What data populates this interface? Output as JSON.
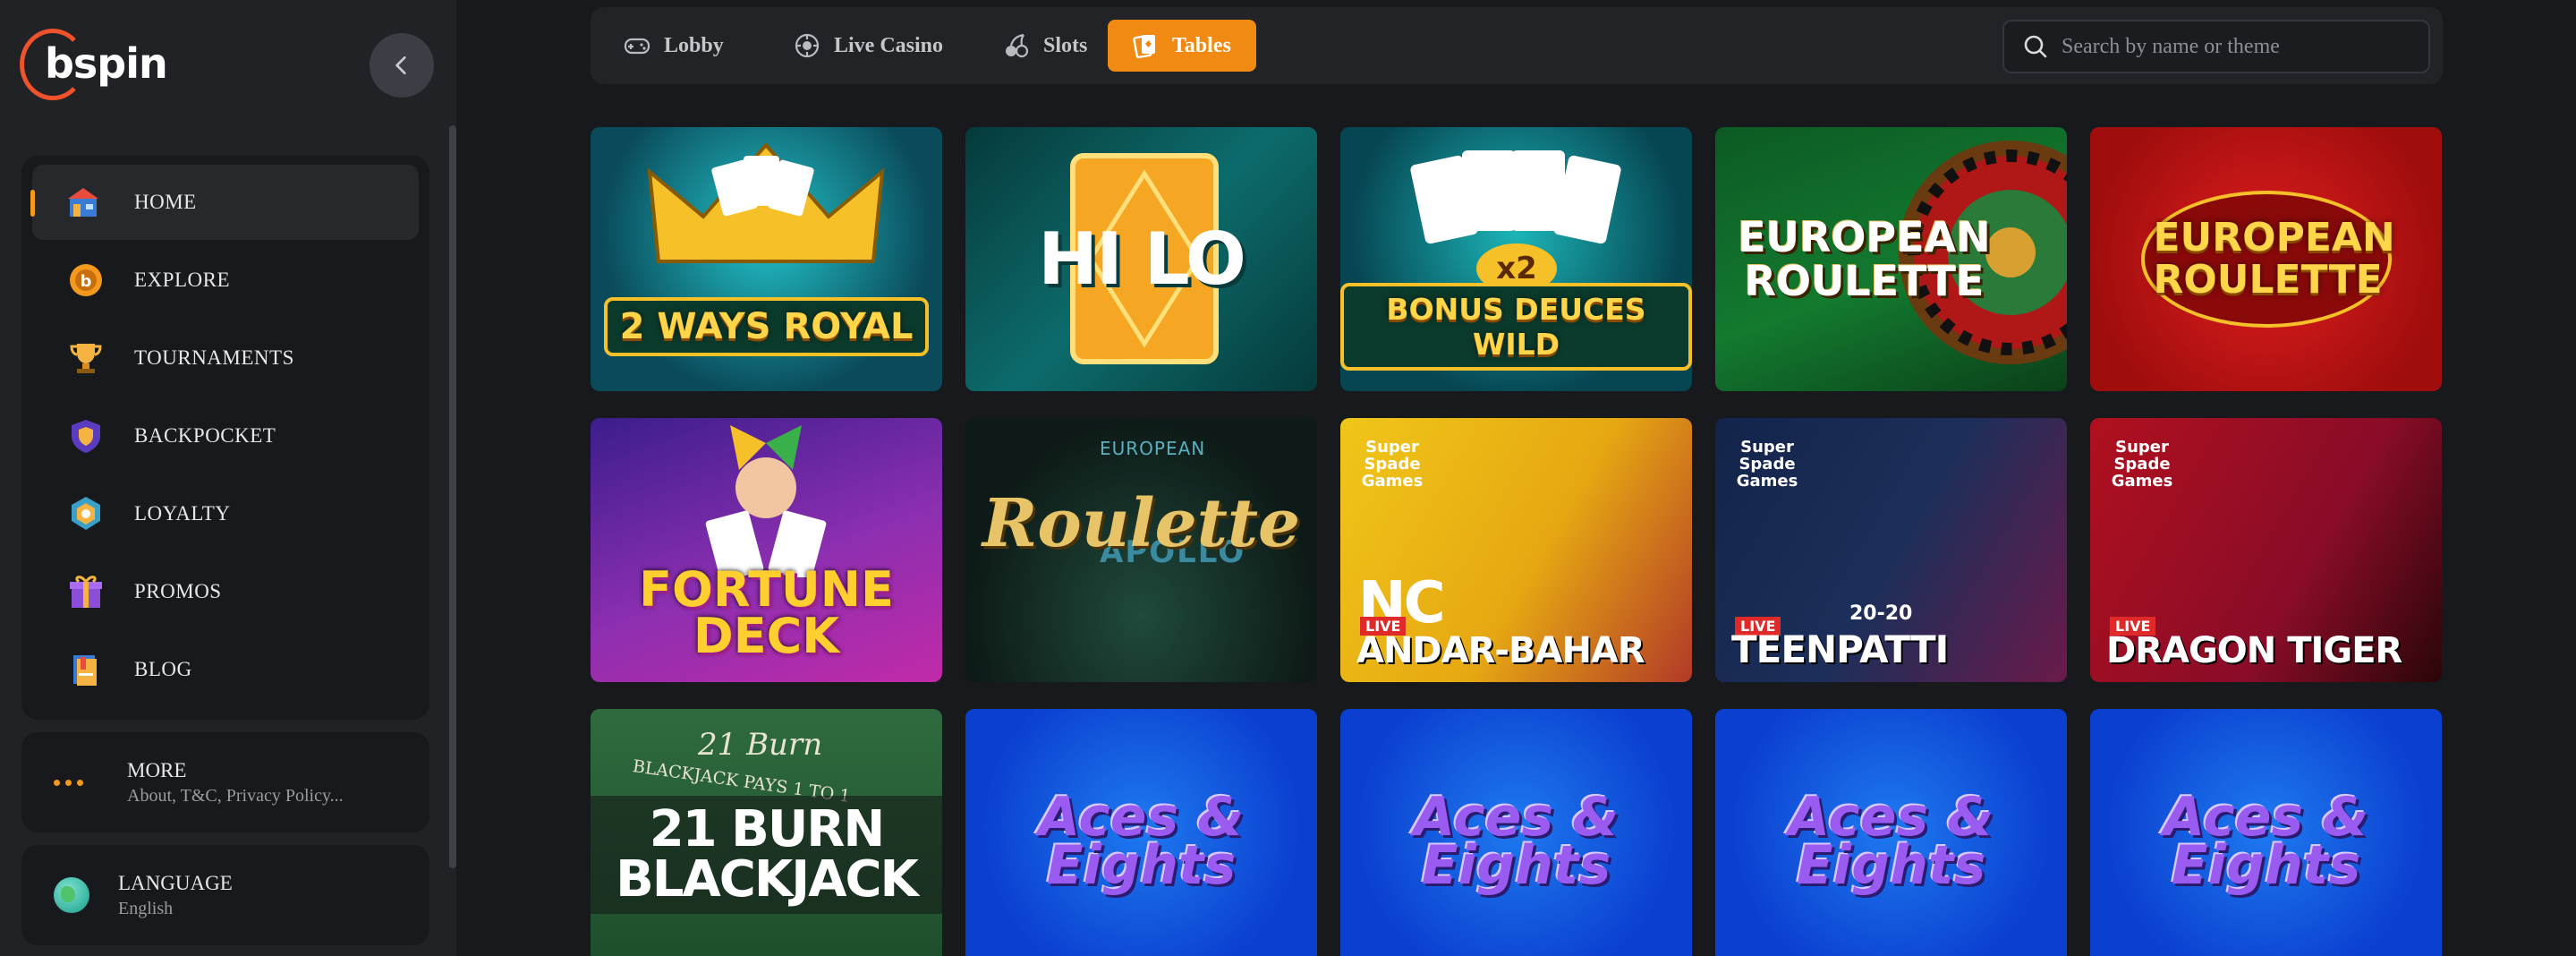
{
  "brand": {
    "name": "bspin"
  },
  "sidebar": {
    "collapse_icon": "chevron-left-icon",
    "items": [
      {
        "label": "HOME",
        "icon": "home-icon",
        "active": true
      },
      {
        "label": "EXPLORE",
        "icon": "explore-icon",
        "active": false
      },
      {
        "label": "TOURNAMENTS",
        "icon": "trophy-icon",
        "active": false
      },
      {
        "label": "BACKPOCKET",
        "icon": "shield-icon",
        "active": false
      },
      {
        "label": "LOYALTY",
        "icon": "loyalty-badge-icon",
        "active": false
      },
      {
        "label": "PROMOS",
        "icon": "gift-icon",
        "active": false
      },
      {
        "label": "BLOG",
        "icon": "book-icon",
        "active": false
      }
    ],
    "more": {
      "label": "MORE",
      "sub": "About, T&C, Privacy Policy..."
    },
    "language": {
      "label": "LANGUAGE",
      "value": "English"
    }
  },
  "topbar": {
    "tabs": [
      {
        "label": "Lobby",
        "icon": "gamepad-icon",
        "active": false
      },
      {
        "label": "Live Casino",
        "icon": "chip-icon",
        "active": false
      },
      {
        "label": "Slots",
        "icon": "cherry-icon",
        "active": false
      },
      {
        "label": "Tables",
        "icon": "cards-icon",
        "active": true
      }
    ],
    "search": {
      "placeholder": "Search by name or theme",
      "value": ""
    }
  },
  "games": [
    {
      "title": "2 WAYS ROYAL"
    },
    {
      "title": "HI LO"
    },
    {
      "title": "BONUS DEUCES WILD",
      "multiplier": "x2"
    },
    {
      "title": "EUROPEAN ROULETTE"
    },
    {
      "title": "EUROPEAN ROULETTE"
    },
    {
      "title": "FORTUNE DECK"
    },
    {
      "title": "Roulette",
      "eyebrow": "EUROPEAN",
      "sub": "APOLLO"
    },
    {
      "title": "ANDAR-BAHAR",
      "prefix": "NC",
      "provider": "Super Spade Games",
      "badge": "LIVE"
    },
    {
      "title": "TEENPATTI",
      "prefix": "20-20",
      "provider": "Super Spade Games",
      "badge": "LIVE"
    },
    {
      "title": "DRAGON TIGER",
      "provider": "Super Spade Games",
      "badge": "LIVE"
    },
    {
      "title": "21 BURN BLACKJACK",
      "eyebrow": "21 Burn",
      "felt": "BLACKJACK PAYS 1 TO 1"
    },
    {
      "title": "Aces & Eights"
    },
    {
      "title": "Aces & Eights"
    },
    {
      "title": "Aces & Eights"
    },
    {
      "title": "Aces & Eights"
    }
  ],
  "colors": {
    "accent": "#f08a12",
    "sidebar_bg": "#202226",
    "page_bg": "#17191c",
    "logo_ring": "#f0522c"
  }
}
